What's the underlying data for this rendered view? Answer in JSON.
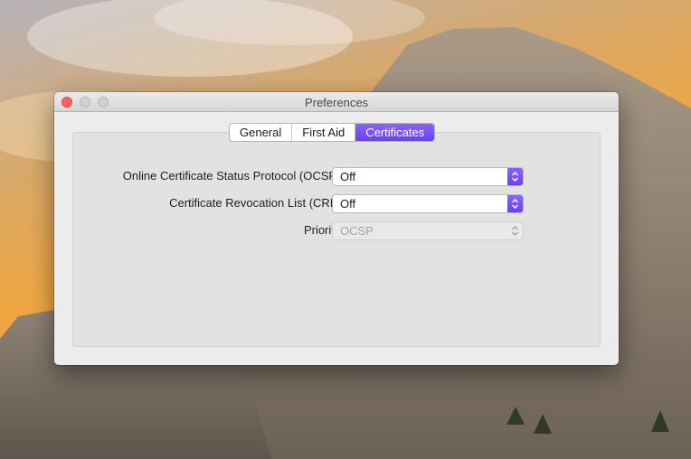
{
  "window": {
    "title": "Preferences"
  },
  "tabs": [
    {
      "label": "General",
      "active": false
    },
    {
      "label": "First Aid",
      "active": false
    },
    {
      "label": "Certificates",
      "active": true
    }
  ],
  "settings": {
    "ocsp": {
      "label": "Online Certificate Status Protocol (OCSP):",
      "value": "Off"
    },
    "crl": {
      "label": "Certificate Revocation List (CRL):",
      "value": "Off"
    },
    "priority": {
      "label": "Priority:",
      "value": "OCSP",
      "disabled": true
    }
  },
  "colors": {
    "accent": "#6b3ef5",
    "close_button": "#fc605c"
  },
  "icons": {
    "popup_arrows": "up-down-chevron-icon"
  }
}
